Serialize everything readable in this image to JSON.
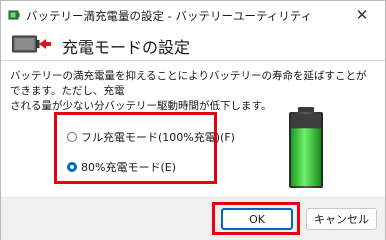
{
  "window": {
    "title": "バッテリー満充電量の設定 - バッテリーユーティリティ",
    "close_glyph": "✕"
  },
  "header": {
    "title": "充電モードの設定"
  },
  "description": "バッテリーの満充電量を抑えることによりバッテリーの寿命を延ばすことができます。ただし、充電\nされる量が少ない分バッテリー駆動時間が低下します。",
  "options": [
    {
      "label": "フル充電モード(100%充電)(F)",
      "checked": false
    },
    {
      "label": "80%充電モード(E)",
      "checked": true
    }
  ],
  "battery": {
    "level": 0.8,
    "fill_color": "#3cc83c"
  },
  "buttons": {
    "ok": "OK",
    "cancel": "キャンセル"
  },
  "colors": {
    "highlight": "#e60012",
    "accent": "#0067c0"
  }
}
